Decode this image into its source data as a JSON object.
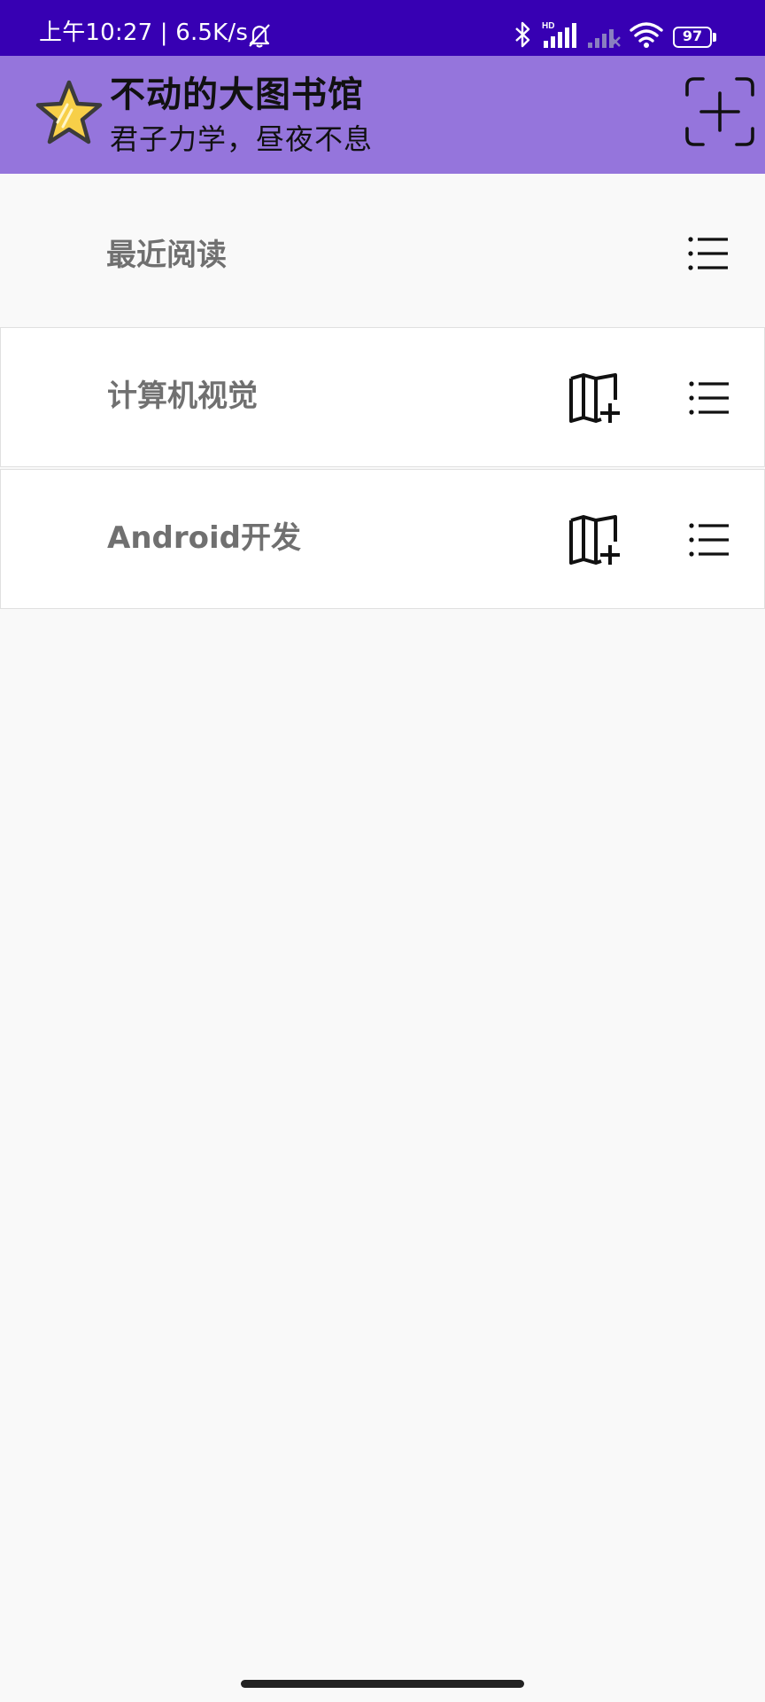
{
  "status_bar": {
    "time": "上午10:27 | 6.5K/s",
    "network_label": "HD",
    "battery_level": "97",
    "icons": [
      "bell-off-icon",
      "bluetooth-icon",
      "hd-signal-icon",
      "signal-no-service-icon",
      "wifi-icon",
      "battery-icon"
    ]
  },
  "header": {
    "title": "不动的大图书馆",
    "subtitle": "君子力学，昼夜不息",
    "logo_icon": "star-icon",
    "add_icon": "scan-add-icon",
    "background_color": "#9575dc",
    "status_color": "#3700b3"
  },
  "recent": {
    "label": "最近阅读",
    "menu_icon": "list-icon"
  },
  "categories": [
    {
      "label": "计算机视觉",
      "add_book_icon": "book-add-icon",
      "menu_icon": "list-icon"
    },
    {
      "label": "Android开发",
      "add_book_icon": "book-add-icon",
      "menu_icon": "list-icon"
    }
  ]
}
